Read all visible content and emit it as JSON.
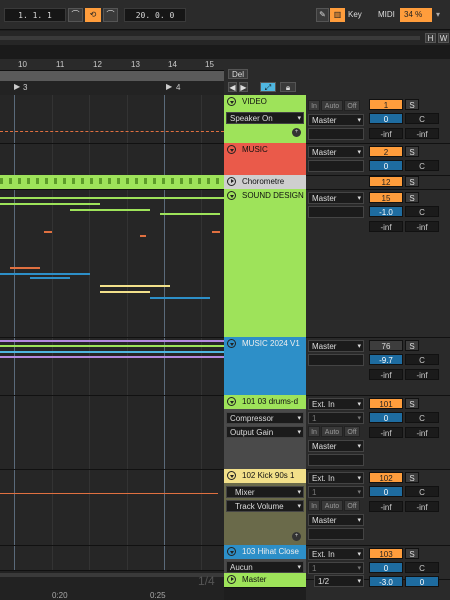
{
  "transport": {
    "position": "1.   1.   1",
    "time": "20.   0.   0",
    "key_label": "Key",
    "midi_label": "MIDI",
    "cpu_value": "34 %"
  },
  "overview": {
    "h_label": "H",
    "w_label": "W"
  },
  "ruler": {
    "marks": [
      "10",
      "11",
      "12",
      "13",
      "14",
      "15"
    ]
  },
  "locators": {
    "first": "3",
    "second": "4"
  },
  "header_buttons": {
    "del_label": "Del"
  },
  "tracks": [
    {
      "name": "VIDEO",
      "color": "#9ee35a",
      "device": "Speaker On",
      "output": "Master"
    },
    {
      "name": "MUSIC",
      "color": "#ea5a4a",
      "output": "Master"
    },
    {
      "name": "Chorometre",
      "color": "#cfcfcf",
      "output": ""
    },
    {
      "name": "SOUND DESIGN",
      "color": "#9ee35a",
      "output": "Master"
    },
    {
      "name": "MUSIC 2024 V1",
      "color": "#2d8fc8",
      "output": "Master"
    },
    {
      "name": "101 03 drums-d",
      "color": "#9ee35a",
      "input": "Ext. In",
      "channel": "1",
      "device": "Compressor",
      "param": "Output Gain",
      "output": "Master"
    },
    {
      "name": "102 Kick 90s 1",
      "color": "#f2e08a",
      "input": "Ext. In",
      "channel": "1",
      "device": "Mixer",
      "param": "Track Volume",
      "output": "Master"
    },
    {
      "name": "103 Hihat Close",
      "color": "#2d8fc8",
      "input": "Ext. In",
      "channel": "1",
      "device": "Aucun",
      "output": "Master",
      "send": "1/2"
    }
  ],
  "mixer": [
    {
      "number": "1",
      "volume": "0",
      "pan": "C",
      "peak_l": "-inf",
      "peak_r": "-inf",
      "s": "S"
    },
    {
      "number": "2",
      "volume": "0",
      "pan": "C",
      "s": "S"
    },
    {
      "number": "12",
      "s": "S"
    },
    {
      "number": "15",
      "volume": "-1.0",
      "pan": "C",
      "peak_l": "-inf",
      "peak_r": "-inf",
      "s": "S"
    },
    {
      "number": "76",
      "volume": "-9.7",
      "pan": "C",
      "peak_l": "-inf",
      "peak_r": "-inf",
      "s": "S"
    },
    {
      "number": "101",
      "volume": "0",
      "pan": "C",
      "peak_l": "-inf",
      "peak_r": "-inf",
      "s": "S"
    },
    {
      "number": "102",
      "volume": "0",
      "pan": "C",
      "peak_l": "-inf",
      "peak_r": "-inf",
      "s": "S"
    },
    {
      "number": "103",
      "volume": "0",
      "pan": "C",
      "master_vol": "-3.0",
      "master_pan": "0",
      "s": "S"
    }
  ],
  "monitor": {
    "in": "In",
    "auto": "Auto",
    "off": "Off"
  },
  "master_track": {
    "name": "Master"
  },
  "bottom": {
    "zoom": "1/4",
    "time1": "0:20",
    "time2": "0:25"
  }
}
